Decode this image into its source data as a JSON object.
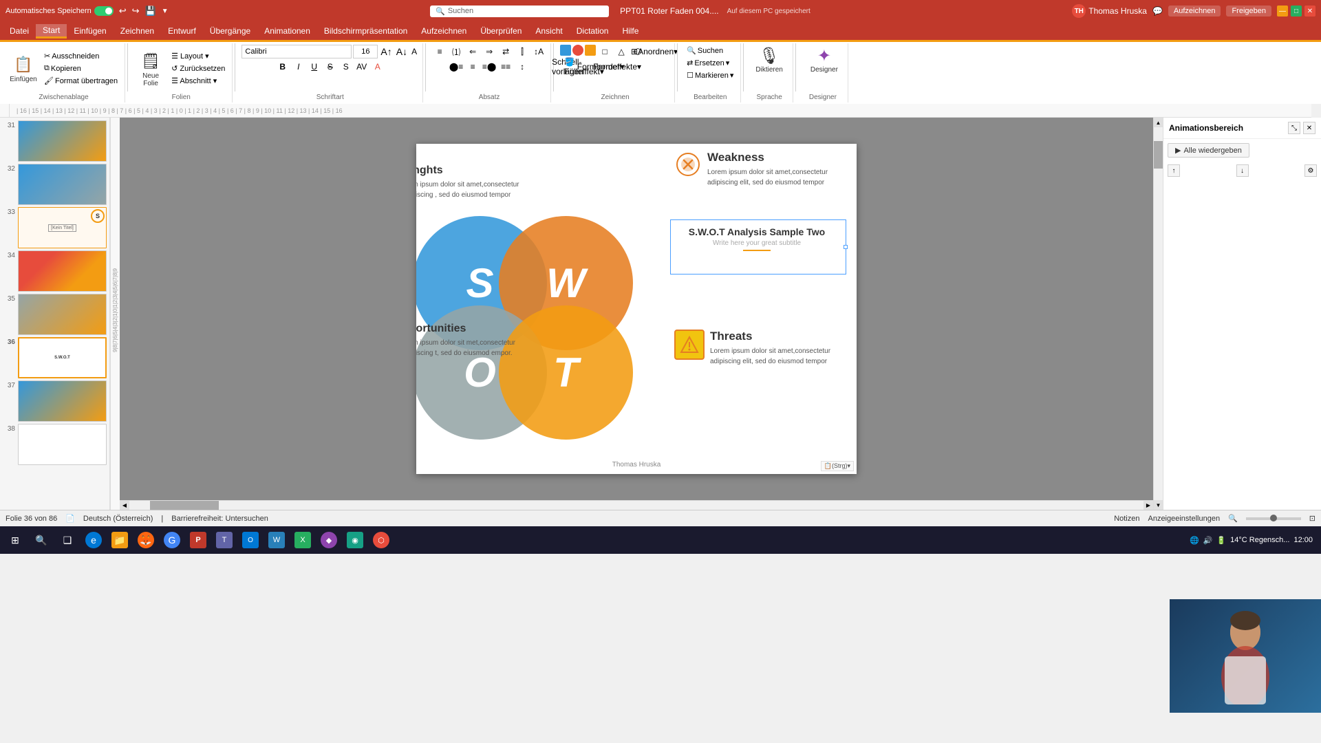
{
  "titlebar": {
    "autosave_label": "Automatisches Speichern",
    "filename": "PPT01 Roter Faden 004....",
    "save_location": "Auf diesem PC gespeichert",
    "search_placeholder": "Suchen",
    "user_name": "Thomas Hruska",
    "user_initials": "TH",
    "record_label": "Aufzeichnen",
    "share_label": "Freigeben",
    "window_icons": {
      "minimize": "—",
      "maximize": "□",
      "close": "✕"
    }
  },
  "menubar": {
    "items": [
      "Datei",
      "Start",
      "Einfügen",
      "Zeichnen",
      "Entwurf",
      "Übergänge",
      "Animationen",
      "Bildschirmpräsentation",
      "Aufzeichnen",
      "Überprüfen",
      "Ansicht",
      "Dictation",
      "Hilfe"
    ]
  },
  "ribbon": {
    "groups": {
      "clipboard": {
        "label": "Zwischenablage",
        "buttons": [
          "Einfügen",
          "Ausschneiden",
          "Kopieren",
          "Format übertragen"
        ]
      },
      "slides": {
        "label": "Folien",
        "buttons": [
          "Neue Folie",
          "Layout",
          "Zurücksetzen",
          "Abschnitt"
        ]
      },
      "font": {
        "label": "Schriftart",
        "size": "16"
      },
      "paragraph": {
        "label": "Absatz"
      },
      "drawing": {
        "label": "Zeichnen"
      },
      "editing": {
        "label": "Bearbeiten",
        "buttons": [
          "Suchen",
          "Ersetzen",
          "Markieren"
        ]
      },
      "voice": {
        "label": "Sprache",
        "diktieren_label": "Diktieren"
      },
      "designer": {
        "label": "Designer",
        "label2": "Designer"
      }
    }
  },
  "slides_panel": {
    "slides": [
      {
        "num": "31",
        "active": false,
        "starred": false
      },
      {
        "num": "32",
        "active": false,
        "starred": true
      },
      {
        "num": "33",
        "active": false,
        "starred": false,
        "has_kein": true
      },
      {
        "num": "34",
        "active": false,
        "starred": false
      },
      {
        "num": "35",
        "active": false,
        "starred": true
      },
      {
        "num": "36",
        "active": true,
        "starred": false
      },
      {
        "num": "37",
        "active": false,
        "starred": false
      },
      {
        "num": "38",
        "active": false,
        "starred": false
      }
    ]
  },
  "slide_content": {
    "title": "S.W.O.T Analysis Sample Two",
    "subtitle": "Write here your great subtitle",
    "circles": [
      "S",
      "W",
      "O",
      "T"
    ],
    "weakness": {
      "heading": "Weakness",
      "text": "Lorem ipsum dolor sit amet,consectetur adipiscing elit, sed do eiusmod tempor"
    },
    "threats": {
      "heading": "Threats",
      "text": "Lorem ipsum dolor sit amet,consectetur adipiscing elit, sed do eiusmod tempor"
    },
    "strengths": {
      "heading": "renghts",
      "text": "orem ipsum dolor sit amet,consectetur adipiscing , sed do eiusmod tempor"
    },
    "opportunities": {
      "heading": "pportunities",
      "text": "orem ipsum dolor sit met,consectetur adipiscing t, sed do eiusmod empor."
    },
    "footer": "Thomas Hruska",
    "ctrl_paste": "(Strg)"
  },
  "animation_panel": {
    "title": "Animationsbereich",
    "play_btn": "Alle wiedergeben"
  },
  "statusbar": {
    "slide_info": "Folie 36 von 86",
    "language": "Deutsch (Österreich)",
    "accessibility": "Barrierefreiheit: Untersuchen",
    "right_items": [
      "Notizen",
      "Anzeigeeinstellungen"
    ]
  },
  "taskbar": {
    "items": [
      {
        "name": "windows-icon",
        "symbol": "⊞"
      },
      {
        "name": "search-taskbar",
        "symbol": "🔍"
      },
      {
        "name": "task-view",
        "symbol": "❑"
      },
      {
        "name": "edge-browser",
        "symbol": "🌐"
      },
      {
        "name": "explorer",
        "symbol": "📁"
      },
      {
        "name": "firefox",
        "symbol": "🦊"
      },
      {
        "name": "chrome",
        "symbol": "●"
      },
      {
        "name": "teams",
        "symbol": "T"
      },
      {
        "name": "todo",
        "symbol": "✓"
      },
      {
        "name": "powerpoint",
        "symbol": "P"
      },
      {
        "name": "app1",
        "symbol": "◆"
      },
      {
        "name": "app2",
        "symbol": "■"
      },
      {
        "name": "app3",
        "symbol": "▲"
      },
      {
        "name": "app4",
        "symbol": "●"
      },
      {
        "name": "app5",
        "symbol": "◉"
      },
      {
        "name": "app6",
        "symbol": "⬟"
      },
      {
        "name": "app7",
        "symbol": "⬡"
      },
      {
        "name": "app8",
        "symbol": "⊕"
      },
      {
        "name": "app9",
        "symbol": "⊗"
      }
    ],
    "system_tray": {
      "temp": "14°C Regensch...",
      "time": "12:00"
    }
  }
}
